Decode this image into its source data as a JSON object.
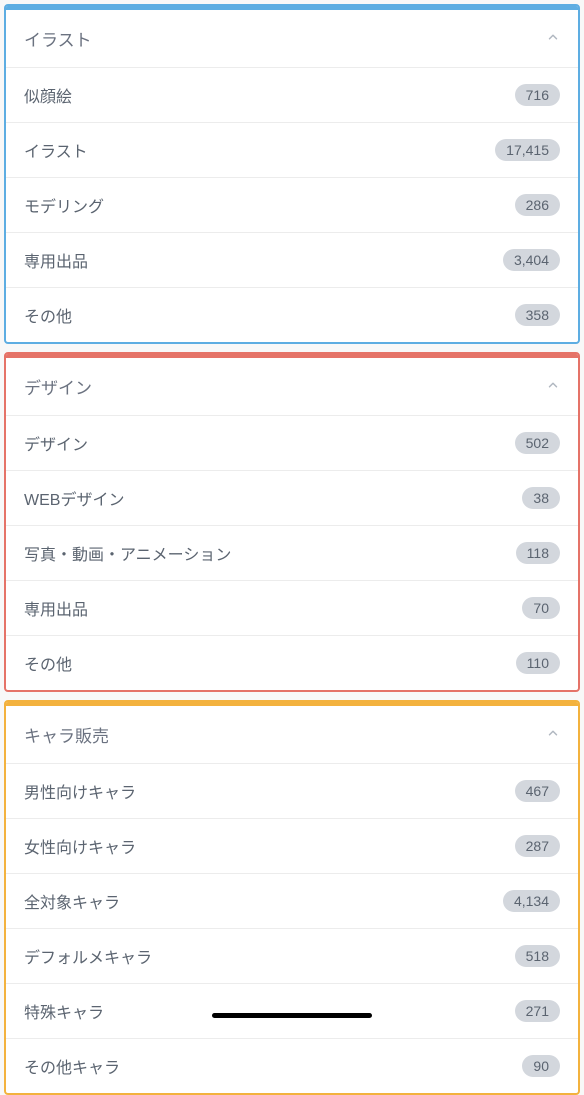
{
  "sections": [
    {
      "title": "イラスト",
      "color": "blue",
      "items": [
        {
          "label": "似顔絵",
          "count": "716"
        },
        {
          "label": "イラスト",
          "count": "17,415"
        },
        {
          "label": "モデリング",
          "count": "286"
        },
        {
          "label": "専用出品",
          "count": "3,404"
        },
        {
          "label": "その他",
          "count": "358"
        }
      ]
    },
    {
      "title": "デザイン",
      "color": "red",
      "items": [
        {
          "label": "デザイン",
          "count": "502"
        },
        {
          "label": "WEBデザイン",
          "count": "38"
        },
        {
          "label": "写真・動画・アニメーション",
          "count": "118"
        },
        {
          "label": "専用出品",
          "count": "70"
        },
        {
          "label": "その他",
          "count": "110"
        }
      ]
    },
    {
      "title": "キャラ販売",
      "color": "orange",
      "items": [
        {
          "label": "男性向けキャラ",
          "count": "467"
        },
        {
          "label": "女性向けキャラ",
          "count": "287"
        },
        {
          "label": "全対象キャラ",
          "count": "4,134"
        },
        {
          "label": "デフォルメキャラ",
          "count": "518"
        },
        {
          "label": "特殊キャラ",
          "count": "271"
        },
        {
          "label": "その他キャラ",
          "count": "90"
        }
      ]
    }
  ]
}
